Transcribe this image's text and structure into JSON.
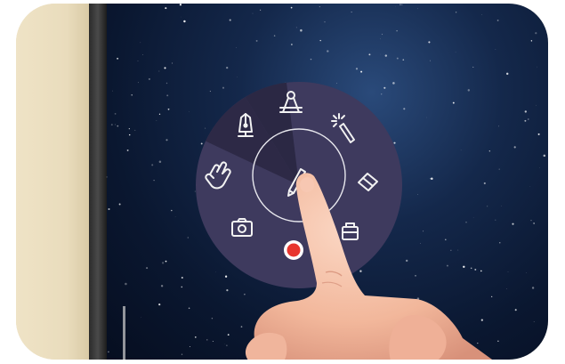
{
  "menu": {
    "center_tool": "pen-icon",
    "tools": [
      {
        "id": "pen",
        "icon": "fountain-pen-icon"
      },
      {
        "id": "compass",
        "icon": "compass-icon"
      },
      {
        "id": "magic",
        "icon": "magic-wand-icon"
      },
      {
        "id": "eraser",
        "icon": "eraser-icon"
      },
      {
        "id": "toolbox",
        "icon": "toolbox-icon"
      },
      {
        "id": "record",
        "icon": "record-icon"
      },
      {
        "id": "screenshot",
        "icon": "camera-icon"
      },
      {
        "id": "hand",
        "icon": "hand-icon"
      }
    ]
  },
  "colors": {
    "menu_bg": "#3e3a5e",
    "menu_highlight": "#2b2844",
    "icon_stroke": "#f2f2f2",
    "record_red": "#e8362f",
    "screen_dark": "#0a1730",
    "bezel": "#e9dcbc"
  }
}
